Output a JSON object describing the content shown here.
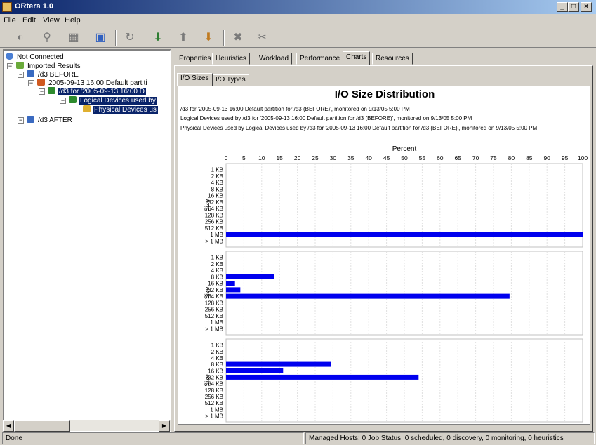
{
  "window": {
    "title": "ORtera 1.0",
    "minimize": "_",
    "maximize": "□",
    "close": "×"
  },
  "menu": [
    "File",
    "Edit",
    "View",
    "Help"
  ],
  "toolbar": [
    "connect-icon",
    "disconnect-icon",
    "hosts-icon",
    "new-window-icon",
    "refresh-icon",
    "import-icon",
    "export-icon",
    "save-icon",
    "delete-icon",
    "cut-icon"
  ],
  "tree": [
    {
      "label": "Not Connected",
      "icon": "globe-icon"
    },
    {
      "label": "Imported Results",
      "icon": "results-icon"
    },
    {
      "label": "/d3 BEFORE",
      "icon": "host-icon"
    },
    {
      "label": "2005-09-13 16:00 Default partiti",
      "icon": "partition-icon"
    },
    {
      "label": "/d3 for '2005-09-13 16:00 D",
      "icon": "shield-icon"
    },
    {
      "label": "Logical Devices used by",
      "icon": "logical-devices-icon"
    },
    {
      "label": "Physical Devices us",
      "icon": "physical-devices-icon"
    },
    {
      "label": "/d3 AFTER",
      "icon": "host-icon"
    }
  ],
  "tabs": [
    "Properties",
    "Heuristics",
    "Workload",
    "Performance",
    "Charts",
    "Resources"
  ],
  "active_tab": "Charts",
  "subtabs": [
    "I/O Sizes",
    "I/O Types"
  ],
  "active_subtab": "I/O Sizes",
  "status": {
    "left": "Done",
    "right": "Managed Hosts: 0 Job Status: 0 scheduled, 0 discovery, 0 monitoring, 0 heuristics"
  },
  "chart_data": {
    "type": "bar",
    "orientation": "horizontal",
    "title": "I/O Size Distribution",
    "subtitles": [
      "/d3 for '2005-09-13 16:00 Default partition for /d3 (BEFORE)', monitored on 9/13/05 5:00 PM",
      "Logical Devices used by /d3 for '2005-09-13 16:00 Default partition for /d3 (BEFORE)', monitored on 9/13/05 5:00 PM",
      "Physical Devices used by Logical Devices used by /d3 for '2005-09-13 16:00 Default partition for /d3 (BEFORE)', monitored on 9/13/05 5:00 PM"
    ],
    "xlabel": "Percent",
    "ylabel": "Size",
    "xlim": [
      0,
      100
    ],
    "xticks": [
      0,
      5,
      10,
      15,
      20,
      25,
      30,
      35,
      40,
      45,
      50,
      55,
      60,
      65,
      70,
      75,
      80,
      85,
      90,
      95,
      100
    ],
    "categories": [
      "1 KB",
      "2 KB",
      "4 KB",
      "8 KB",
      "16 KB",
      "32 KB",
      "64 KB",
      "128 KB",
      "256 KB",
      "512 KB",
      "1 MB",
      "> 1 MB"
    ],
    "grid": true,
    "bar_color": "#0000ee",
    "panels": [
      {
        "values": [
          0,
          0,
          0,
          0,
          0,
          0,
          0,
          0,
          0,
          0,
          100,
          0
        ]
      },
      {
        "values": [
          0,
          0,
          0,
          13.5,
          2.5,
          4,
          79.5,
          0,
          0,
          0,
          0,
          0
        ]
      },
      {
        "values": [
          0,
          0,
          0,
          29.5,
          16,
          54,
          0,
          0,
          0,
          0,
          0,
          0
        ]
      }
    ]
  }
}
